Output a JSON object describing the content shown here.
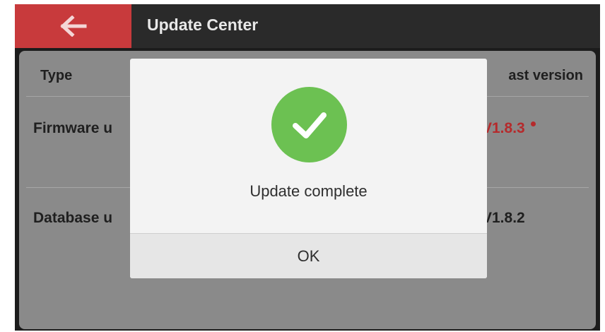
{
  "header": {
    "back_icon": "arrow-left-icon",
    "title": "Update Center"
  },
  "table": {
    "columns": [
      "Type",
      "ast version"
    ],
    "rows": [
      {
        "name": "Firmware u",
        "version": "V1.8.3",
        "has_update_dot": true,
        "version_color": "#b52a2c"
      },
      {
        "name": "Database u",
        "version": "V1.8.2",
        "has_update_dot": false,
        "version_color": "#1f1f1f"
      }
    ]
  },
  "dialog": {
    "icon": "check-circle-icon",
    "icon_color": "#6cc152",
    "message": "Update complete",
    "ok_label": "OK"
  },
  "colors": {
    "accent": "#c83a3c",
    "header_bg": "#2a2a2a"
  }
}
